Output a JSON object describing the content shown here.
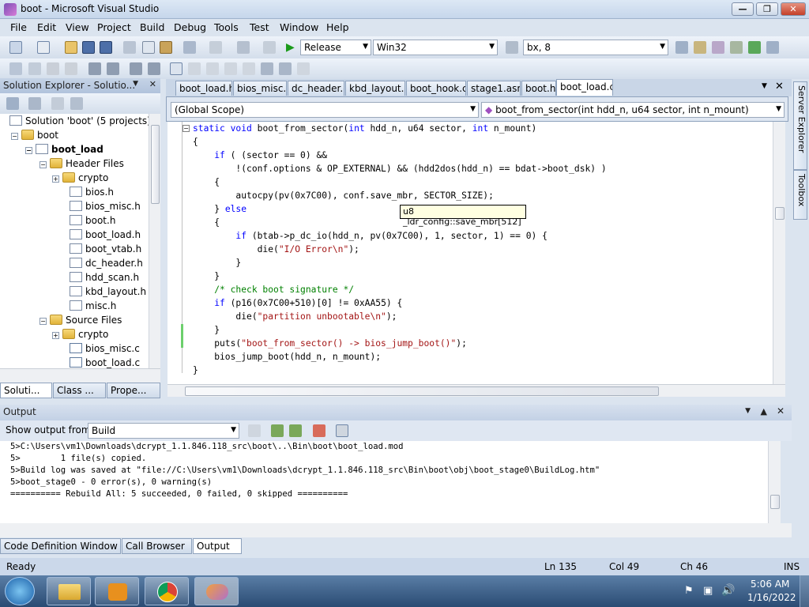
{
  "window": {
    "title": "boot - Microsoft Visual Studio",
    "minimize": "0",
    "restore": "1",
    "close": "r"
  },
  "menu": [
    "File",
    "Edit",
    "View",
    "Project",
    "Build",
    "Debug",
    "Tools",
    "Test",
    "Window",
    "Help"
  ],
  "toolbar": {
    "config": "Release",
    "platform": "Win32",
    "find": "bx, 8"
  },
  "solution_explorer": {
    "title": "Solution Explorer - Solutio...",
    "items": [
      {
        "label": "Solution 'boot' (5 projects)",
        "type": "solution"
      },
      {
        "label": "boot",
        "type": "folder"
      },
      {
        "label": "boot_load",
        "type": "project"
      },
      {
        "label": "Header Files",
        "type": "folder"
      },
      {
        "label": "crypto",
        "type": "folder"
      },
      {
        "label": "bios.h",
        "type": "h"
      },
      {
        "label": "bios_misc.h",
        "type": "h"
      },
      {
        "label": "boot.h",
        "type": "h"
      },
      {
        "label": "boot_load.h",
        "type": "h"
      },
      {
        "label": "boot_vtab.h",
        "type": "h"
      },
      {
        "label": "dc_header.h",
        "type": "h"
      },
      {
        "label": "hdd_scan.h",
        "type": "h"
      },
      {
        "label": "kbd_layout.h",
        "type": "h"
      },
      {
        "label": "misc.h",
        "type": "h"
      },
      {
        "label": "Source Files",
        "type": "folder"
      },
      {
        "label": "crypto",
        "type": "folder"
      },
      {
        "label": "bios_misc.c",
        "type": "c"
      },
      {
        "label": "boot_load.c",
        "type": "c"
      }
    ],
    "tabs": [
      "Soluti...",
      "Class ...",
      "Prope..."
    ]
  },
  "doc_tabs": [
    "boot_load.h",
    "bios_misc.c",
    "dc_header.c",
    "kbd_layout.c",
    "boot_hook.c",
    "stage1.asm",
    "boot.h",
    "boot_load.c"
  ],
  "editor": {
    "scope": "(Global Scope)",
    "function": "boot_from_sector(int hdd_n, u64 sector, int n_mount)",
    "tooltip": "u8 _ldr_config::save_mbr[512]"
  },
  "output": {
    "title": "Output",
    "show_label": "Show output from:",
    "source": "Build",
    "lines": [
      "5>C:\\Users\\vm1\\Downloads\\dcrypt_1.1.846.118_src\\boot\\..\\Bin\\boot\\boot_load.mod",
      "5>        1 file(s) copied.",
      "5>Build log was saved at \"file://C:\\Users\\vm1\\Downloads\\dcrypt_1.1.846.118_src\\Bin\\boot\\obj\\boot_stage0\\BuildLog.htm\"",
      "5>boot_stage0 - 0 error(s), 0 warning(s)",
      "========== Rebuild All: 5 succeeded, 0 failed, 0 skipped =========="
    ]
  },
  "bottom_tabs": [
    "Code Definition Window",
    "Call Browser",
    "Output"
  ],
  "side_tabs": [
    "Server Explorer",
    "Toolbox"
  ],
  "status": {
    "ready": "Ready",
    "ln": "Ln 135",
    "col": "Col 49",
    "ch": "Ch 46",
    "ins": "INS"
  },
  "tray": {
    "time": "5:06 AM",
    "date": "1/16/2022"
  }
}
